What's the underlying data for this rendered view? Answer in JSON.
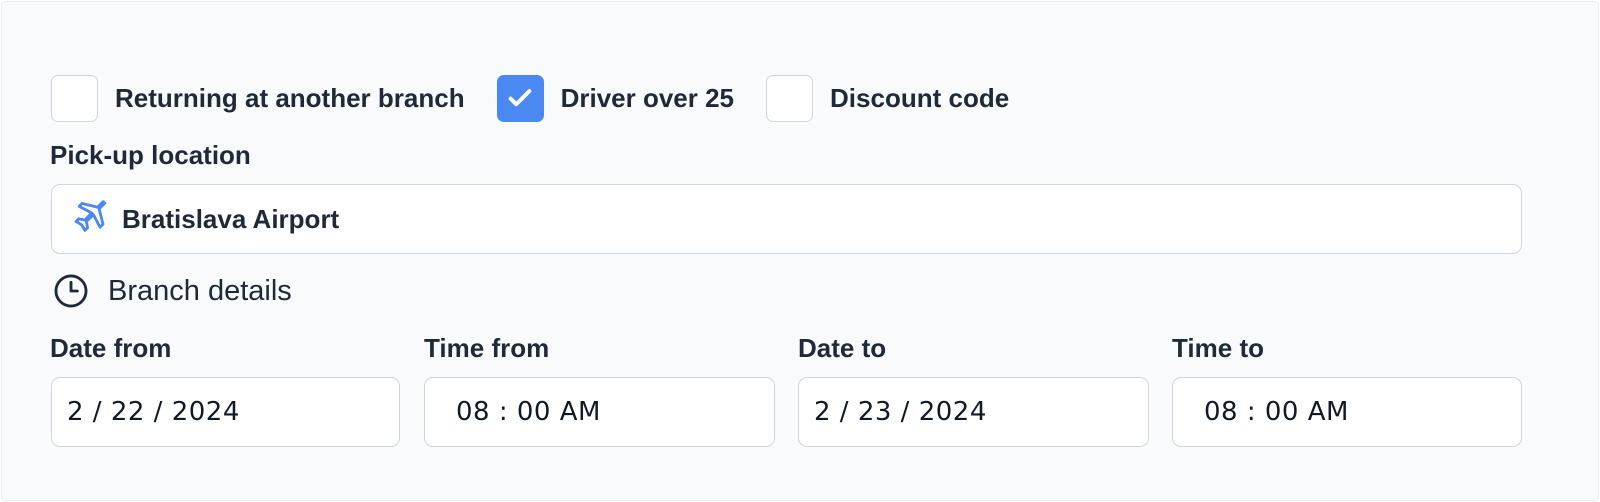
{
  "options": {
    "return_other_branch": {
      "label": "Returning at another branch",
      "checked": false
    },
    "driver_over_25": {
      "label": "Driver over 25",
      "checked": true
    },
    "discount_code": {
      "label": "Discount code",
      "checked": false
    }
  },
  "pickup": {
    "label": "Pick-up location",
    "value": "Bratislava Airport",
    "icon": "airplane-icon"
  },
  "branch_details": {
    "label": "Branch details",
    "icon": "clock-icon"
  },
  "date_from": {
    "label": "Date from",
    "value": "2 / 22 / 2024"
  },
  "time_from": {
    "label": "Time from",
    "value": "08 : 00 AM"
  },
  "date_to": {
    "label": "Date to",
    "value": "2 / 23 / 2024"
  },
  "time_to": {
    "label": "Time to",
    "value": "08 : 00 AM"
  },
  "colors": {
    "accent": "#4a88f2",
    "border": "#d1d5db",
    "text": "#1f2937"
  }
}
